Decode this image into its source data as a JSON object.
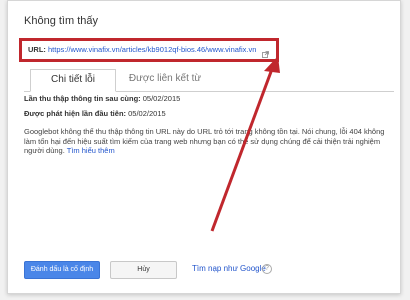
{
  "dialog": {
    "title": "Không tìm thấy",
    "url_label": "URL:",
    "url": "https://www.vinafix.vn/articles/kb9012qf-bios.46/www.vinafix.vn",
    "tabs": [
      {
        "label": "Chi tiết lỗi",
        "active": true
      },
      {
        "label": "Được liên kết từ",
        "active": false
      }
    ],
    "last_crawled_label": "Lần thu thập thông tin sau cùng:",
    "last_crawled_value": "05/02/2015",
    "first_detected_label": "Được phát hiện lần đầu tiên:",
    "first_detected_value": "05/02/2015",
    "description": "Googlebot không thể thu thập thông tin URL này do URL trỏ tới trang không tồn tại. Nói chung, lỗi 404 không làm tổn hại đến hiệu suất tìm kiếm của trang web nhưng bạn có thể sử dụng chúng để cải thiện trải nghiệm người dùng.",
    "learn_more": "Tìm hiểu thêm"
  },
  "footer": {
    "mark_fixed_label": "Đánh dấu là cố định",
    "cancel_label": "Hủy",
    "fetch_as_google_label": "Tìm nạp như Google",
    "help_glyph": "?"
  },
  "colors": {
    "highlight": "#c0272d",
    "primary": "#4a86e8",
    "link": "#2255cc"
  },
  "icons": [
    "external-link-icon",
    "help-icon",
    "annotation-arrow"
  ]
}
